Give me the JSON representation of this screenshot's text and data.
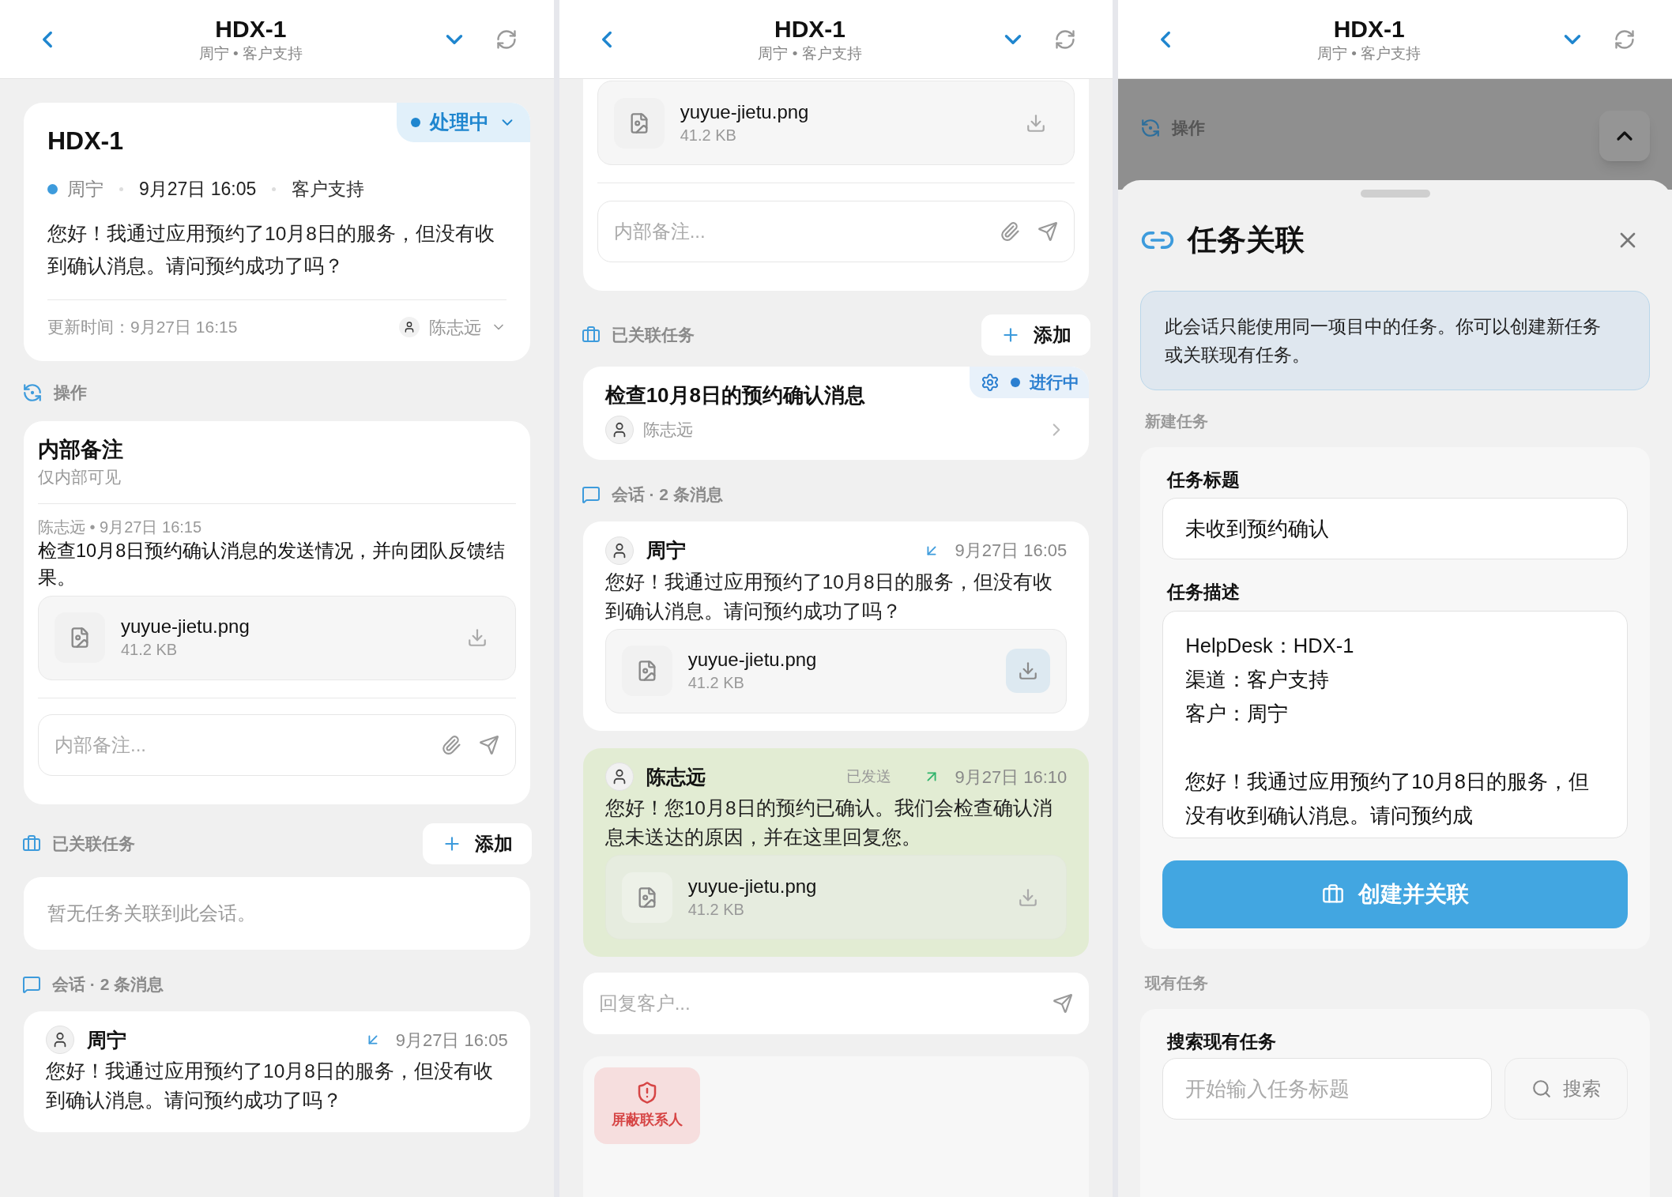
{
  "screens": [
    {
      "kind": "overview",
      "header": {
        "title": "HDX-1",
        "subtitle": "周宁 • 客户支持"
      },
      "ticket": {
        "title": "HDX-1",
        "status": "处理中",
        "customer": "周宁",
        "time": "9月27日 16:05",
        "channel": "客户支持",
        "message": "您好！我通过应用预约了10月8日的服务，但没有收到确认消息。请问预约成功了吗？",
        "updated": "更新时间：9月27日 16:15",
        "assignee": "陈志远"
      },
      "actions": {
        "label": "操作"
      },
      "internal_notes": {
        "title": "内部备注",
        "subtitle": "仅内部可见",
        "notes": [
          {
            "meta": "陈志远 • 9月27日 16:15",
            "text": "检查10月8日预约确认消息的发送情况，并向团队反馈结果。",
            "attachment": {
              "name": "yuyue-jietu.png",
              "size": "41.2 KB",
              "highlighted": false
            }
          }
        ],
        "input": {
          "placeholder": "内部备注..."
        }
      },
      "linked_tasks": {
        "label": "已关联任务",
        "add": "添加",
        "empty": "暂无任务关联到此会话。"
      },
      "conversation": {
        "label": "会话 · 2 条消息",
        "messages": [
          {
            "sender": "周宁",
            "kind": "incoming",
            "time": "9月27日 16:05",
            "text": "您好！我通过应用预约了10月8日的服务，但没有收到确认消息。请问预约成功了吗？"
          }
        ]
      }
    },
    {
      "kind": "scrolled",
      "header": {
        "title": "HDX-1",
        "subtitle": "周宁 • 客户支持"
      },
      "internal_notes": {
        "attachment": {
          "name": "yuyue-jietu.png",
          "size": "41.2 KB",
          "highlighted": false
        },
        "input": {
          "placeholder": "内部备注..."
        }
      },
      "linked_tasks": {
        "label": "已关联任务",
        "add": "添加",
        "tasks": [
          {
            "title": "检查10月8日的预约确认消息",
            "status": "进行中",
            "assignee": "陈志远"
          }
        ]
      },
      "conversation": {
        "label": "会话 · 2 条消息",
        "messages": [
          {
            "sender": "周宁",
            "kind": "incoming",
            "time": "9月27日 16:05",
            "text": "您好！我通过应用预约了10月8日的服务，但没有收到确认消息。请问预约成功了吗？",
            "attachment": {
              "name": "yuyue-jietu.png",
              "size": "41.2 KB",
              "highlighted": true
            }
          },
          {
            "sender": "陈志远",
            "kind": "outgoing",
            "status": "已发送",
            "time": "9月27日 16:10",
            "text": "您好！您10月8日的预约已确认。我们会检查确认消息未送达的原因，并在这里回复您。",
            "attachment": {
              "name": "yuyue-jietu.png",
              "size": "41.2 KB",
              "highlighted": false
            }
          }
        ]
      },
      "reply": {
        "placeholder": "回复客户..."
      },
      "block_button": "屏蔽联系人"
    },
    {
      "kind": "sheet",
      "header": {
        "title": "HDX-1",
        "subtitle": "周宁 • 客户支持"
      },
      "background": {
        "label": "操作"
      },
      "sheet": {
        "title": "任务关联",
        "info": "此会话只能使用同一项目中的任务。你可以创建新任务或关联现有任务。",
        "new_task": {
          "label": "新建任务",
          "title_label": "任务标题",
          "title_value": "未收到预约确认",
          "desc_label": "任务描述",
          "desc_lines": [
            "HelpDesk：HDX-1",
            "渠道：客户支持",
            "客户：周宁"
          ],
          "desc_paragraph": "您好！我通过应用预约了10月8日的服务，但没有收到确认消息。请问预约成",
          "submit": "创建并关联"
        },
        "existing": {
          "label": "现有任务",
          "search_label": "搜索现有任务",
          "placeholder": "开始输入任务标题",
          "search": "搜索"
        }
      }
    }
  ]
}
